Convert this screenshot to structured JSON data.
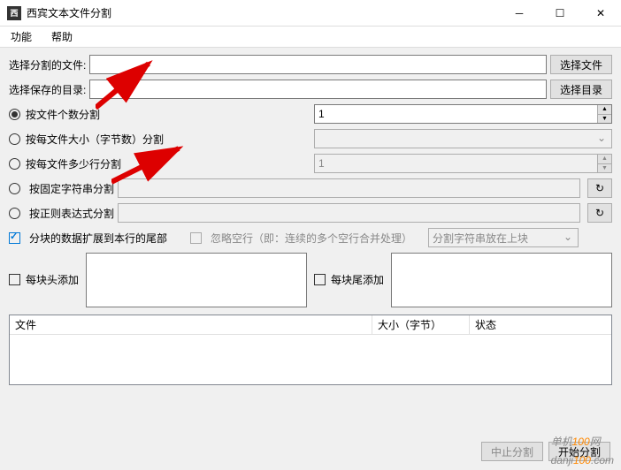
{
  "window": {
    "title": "西宾文本文件分割"
  },
  "menu": {
    "func": "功能",
    "help": "帮助"
  },
  "labels": {
    "selectFile": "选择分割的文件:",
    "selectDir": "选择保存的目录:"
  },
  "buttons": {
    "chooseFile": "选择文件",
    "chooseDir": "选择目录",
    "stop": "中止分割",
    "start": "开始分割"
  },
  "options": {
    "byCount": "按文件个数分割",
    "bySize": "按每文件大小（字节数）分割",
    "byLines": "按每文件多少行分割",
    "byString": "按固定字符串分割",
    "byRegex": "按正则表达式分割"
  },
  "values": {
    "count": "1",
    "size": "",
    "lines": "1",
    "string": "",
    "regex": ""
  },
  "checks": {
    "extend": "分块的数据扩展到本行的尾部",
    "ignoreEmpty": "忽略空行（即：连续的多个空行合并处理）"
  },
  "combo": {
    "placement": "分割字符串放在上块"
  },
  "append": {
    "head": "每块头添加",
    "tail": "每块尾添加"
  },
  "table": {
    "file": "文件",
    "size": "大小（字节）",
    "status": "状态"
  },
  "watermark": {
    "a": "单机",
    "b": "100",
    "c": "网",
    "d": "danji",
    "e": "100",
    "f": ".com"
  }
}
